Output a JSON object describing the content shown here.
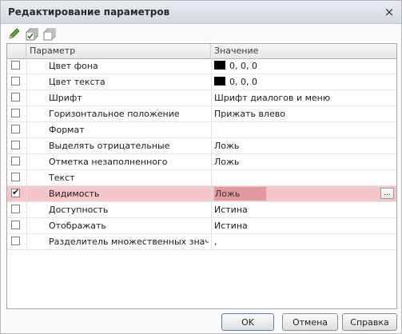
{
  "window": {
    "title": "Редактирование параметров",
    "close_glyph": "×"
  },
  "toolbar": {
    "icons": [
      "pencil-icon",
      "check-all-icon",
      "uncheck-all-icon"
    ]
  },
  "table": {
    "columns": [
      "Параметр",
      "Значение"
    ],
    "rows": [
      {
        "checked": false,
        "param": "Цвет фона",
        "value": "0, 0, 0",
        "swatch": "#000000"
      },
      {
        "checked": false,
        "param": "Цвет текста",
        "value": "0, 0, 0",
        "swatch": "#000000"
      },
      {
        "checked": false,
        "param": "Шрифт",
        "value": "Шрифт диалогов и меню"
      },
      {
        "checked": false,
        "param": "Горизонтальное положение",
        "value": "Прижать влево"
      },
      {
        "checked": false,
        "param": "Формат",
        "value": ""
      },
      {
        "checked": false,
        "param": "Выделять отрицательные",
        "value": "Ложь"
      },
      {
        "checked": false,
        "param": "Отметка незаполненного",
        "value": "Ложь"
      },
      {
        "checked": false,
        "param": "Текст",
        "value": ""
      },
      {
        "checked": true,
        "param": "Видимость",
        "value": "Ложь",
        "selected": true,
        "ellipsis": "..."
      },
      {
        "checked": false,
        "param": "Доступность",
        "value": "Истина"
      },
      {
        "checked": false,
        "param": "Отображать",
        "value": "Истина"
      },
      {
        "checked": false,
        "param": "Разделитель множественных значений",
        "value": ","
      }
    ]
  },
  "buttons": {
    "ok": "OK",
    "cancel": "Отмена",
    "help": "Справка"
  },
  "colors": {
    "selected_row": "#f5c6c8",
    "selected_value": "#e39a9f",
    "title_bar": "#dde2e9"
  }
}
